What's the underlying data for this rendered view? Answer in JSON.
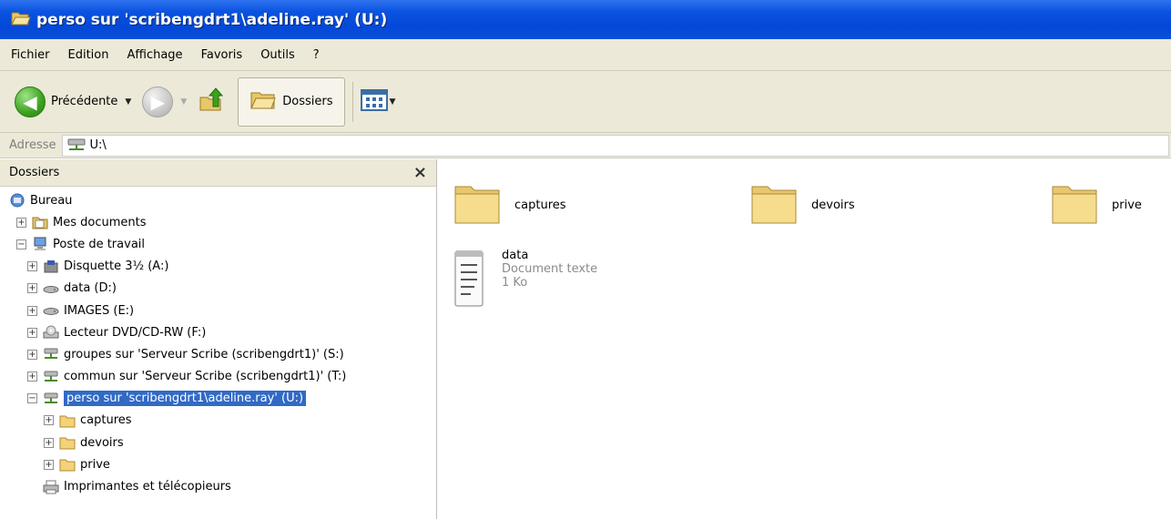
{
  "window": {
    "title": "perso sur 'scribengdrt1\\adeline.ray' (U:)"
  },
  "menu": [
    "Fichier",
    "Edition",
    "Affichage",
    "Favoris",
    "Outils",
    "?"
  ],
  "toolbar": {
    "back_label": "Précédente",
    "folders_label": "Dossiers"
  },
  "address": {
    "label": "Adresse",
    "value": "U:\\"
  },
  "folder_pane": {
    "title": "Dossiers",
    "close_glyph": "×",
    "tree": [
      {
        "label": "Bureau",
        "expander": "",
        "level": 0,
        "icon": "desktop-icon"
      },
      {
        "label": "Mes documents",
        "expander": "+",
        "level": 1,
        "icon": "my-documents-icon"
      },
      {
        "label": "Poste de travail",
        "expander": "−",
        "level": 1,
        "icon": "my-computer-icon"
      },
      {
        "label": "Disquette 3½ (A:)",
        "expander": "+",
        "level": 2,
        "icon": "floppy-icon"
      },
      {
        "label": "data (D:)",
        "expander": "+",
        "level": 2,
        "icon": "hard-drive-icon"
      },
      {
        "label": "IMAGES (E:)",
        "expander": "+",
        "level": 2,
        "icon": "hard-drive-icon"
      },
      {
        "label": "Lecteur DVD/CD-RW (F:)",
        "expander": "+",
        "level": 2,
        "icon": "dvd-drive-icon"
      },
      {
        "label": "groupes sur 'Serveur Scribe (scribengdrt1)' (S:)",
        "expander": "+",
        "level": 2,
        "icon": "network-drive-icon"
      },
      {
        "label": "commun sur 'Serveur Scribe (scribengdrt1)' (T:)",
        "expander": "+",
        "level": 2,
        "icon": "network-drive-icon"
      },
      {
        "label": "perso sur 'scribengdrt1\\adeline.ray' (U:)",
        "expander": "−",
        "level": 2,
        "icon": "network-drive-icon",
        "selected": true
      },
      {
        "label": "captures",
        "expander": "+",
        "level": 3,
        "icon": "folder-icon"
      },
      {
        "label": "devoirs",
        "expander": "+",
        "level": 3,
        "icon": "folder-icon"
      },
      {
        "label": "prive",
        "expander": "+",
        "level": 3,
        "icon": "folder-icon"
      },
      {
        "label": "Imprimantes et télécopieurs",
        "expander": "",
        "level": 2,
        "icon": "printer-icon"
      }
    ]
  },
  "content": {
    "folders": [
      "captures",
      "devoirs",
      "prive"
    ],
    "file": {
      "name": "data",
      "type": "Document texte",
      "size": "1 Ko"
    }
  },
  "colors": {
    "titlebar": "#0348d8",
    "chrome": "#ece9d8",
    "selection": "#316ac5",
    "folder": "#f5d77b"
  }
}
